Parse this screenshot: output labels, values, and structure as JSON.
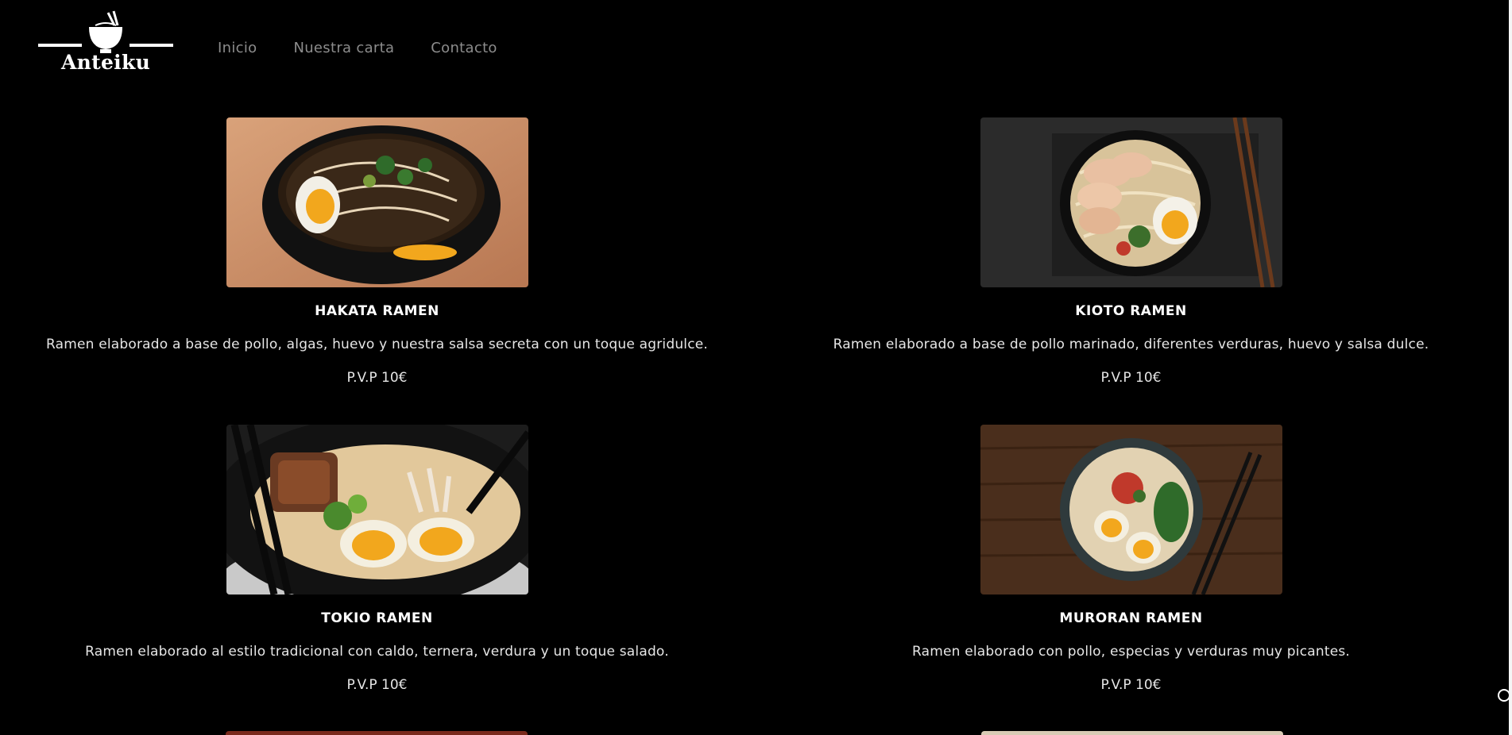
{
  "brand": {
    "name": "Anteiku"
  },
  "nav": {
    "items": [
      "Inicio",
      "Nuestra carta",
      "Contacto"
    ]
  },
  "menu": [
    {
      "name": "HAKATA RAMEN",
      "description": "Ramen elaborado a base de pollo, algas, huevo y nuestra salsa secreta con un toque agridulce.",
      "price": "P.V.P 10€"
    },
    {
      "name": "KIOTO RAMEN",
      "description": "Ramen elaborado a base de pollo marinado, diferentes verduras, huevo y salsa dulce.",
      "price": "P.V.P 10€"
    },
    {
      "name": "TOKIO RAMEN",
      "description": "Ramen elaborado al estilo tradicional con caldo, ternera, verdura y un toque salado.",
      "price": "P.V.P 10€"
    },
    {
      "name": "MURORAN RAMEN",
      "description": "Ramen elaborado con pollo, especias y verduras muy picantes.",
      "price": "P.V.P 10€"
    }
  ],
  "colors": {
    "background": "#000000",
    "nav_text": "#8c8c8c",
    "text": "#f2f2f2"
  }
}
